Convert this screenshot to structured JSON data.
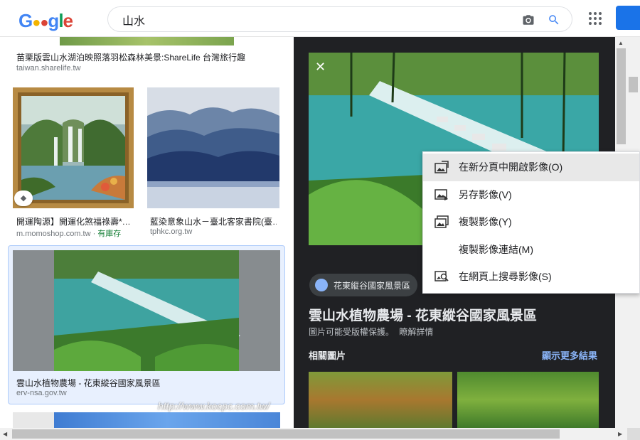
{
  "logo": {
    "text": "Google"
  },
  "search": {
    "query": "山水"
  },
  "results": [
    {
      "caption": "苗栗版雲山水湖泊映照落羽松森林美景:ShareLife 台灣旅行趣",
      "source": "taiwan.sharelife.tw"
    },
    {
      "caption": "開運陶源】開運化煞福祿壽*…",
      "source": "m.momoshop.com.tw",
      "extra": "有庫存"
    },
    {
      "caption": "藍染意象山水－臺北客家書院(臺…",
      "source": "tphkc.org.tw"
    },
    {
      "caption": "雲山水植物農場 - 花東縱谷國家風景區",
      "source": "erv-nsa.gov.tw"
    }
  ],
  "panel": {
    "source_label": "花東縱谷國家風景區",
    "title": "雲山水植物農場 - 花東縱谷國家風景區",
    "copyright": "圖片可能受版權保護。",
    "copyright_link": "瞭解詳情",
    "related_title": "相關圖片",
    "related_more": "顯示更多結果"
  },
  "context_menu": [
    {
      "label": "在新分頁中開啟影像(O)",
      "icon": "open-image-icon"
    },
    {
      "label": "另存影像(V)",
      "icon": "save-image-icon"
    },
    {
      "label": "複製影像(Y)",
      "icon": "copy-image-icon"
    },
    {
      "label": "複製影像連結(M)",
      "icon": ""
    },
    {
      "label": "在網頁上搜尋影像(S)",
      "icon": "search-image-icon"
    }
  ],
  "watermark": "http://www.kocpc.com.tw/",
  "colors": {
    "accent": "#1a73e8",
    "panel_bg": "#202124",
    "link": "#8ab4f8"
  }
}
